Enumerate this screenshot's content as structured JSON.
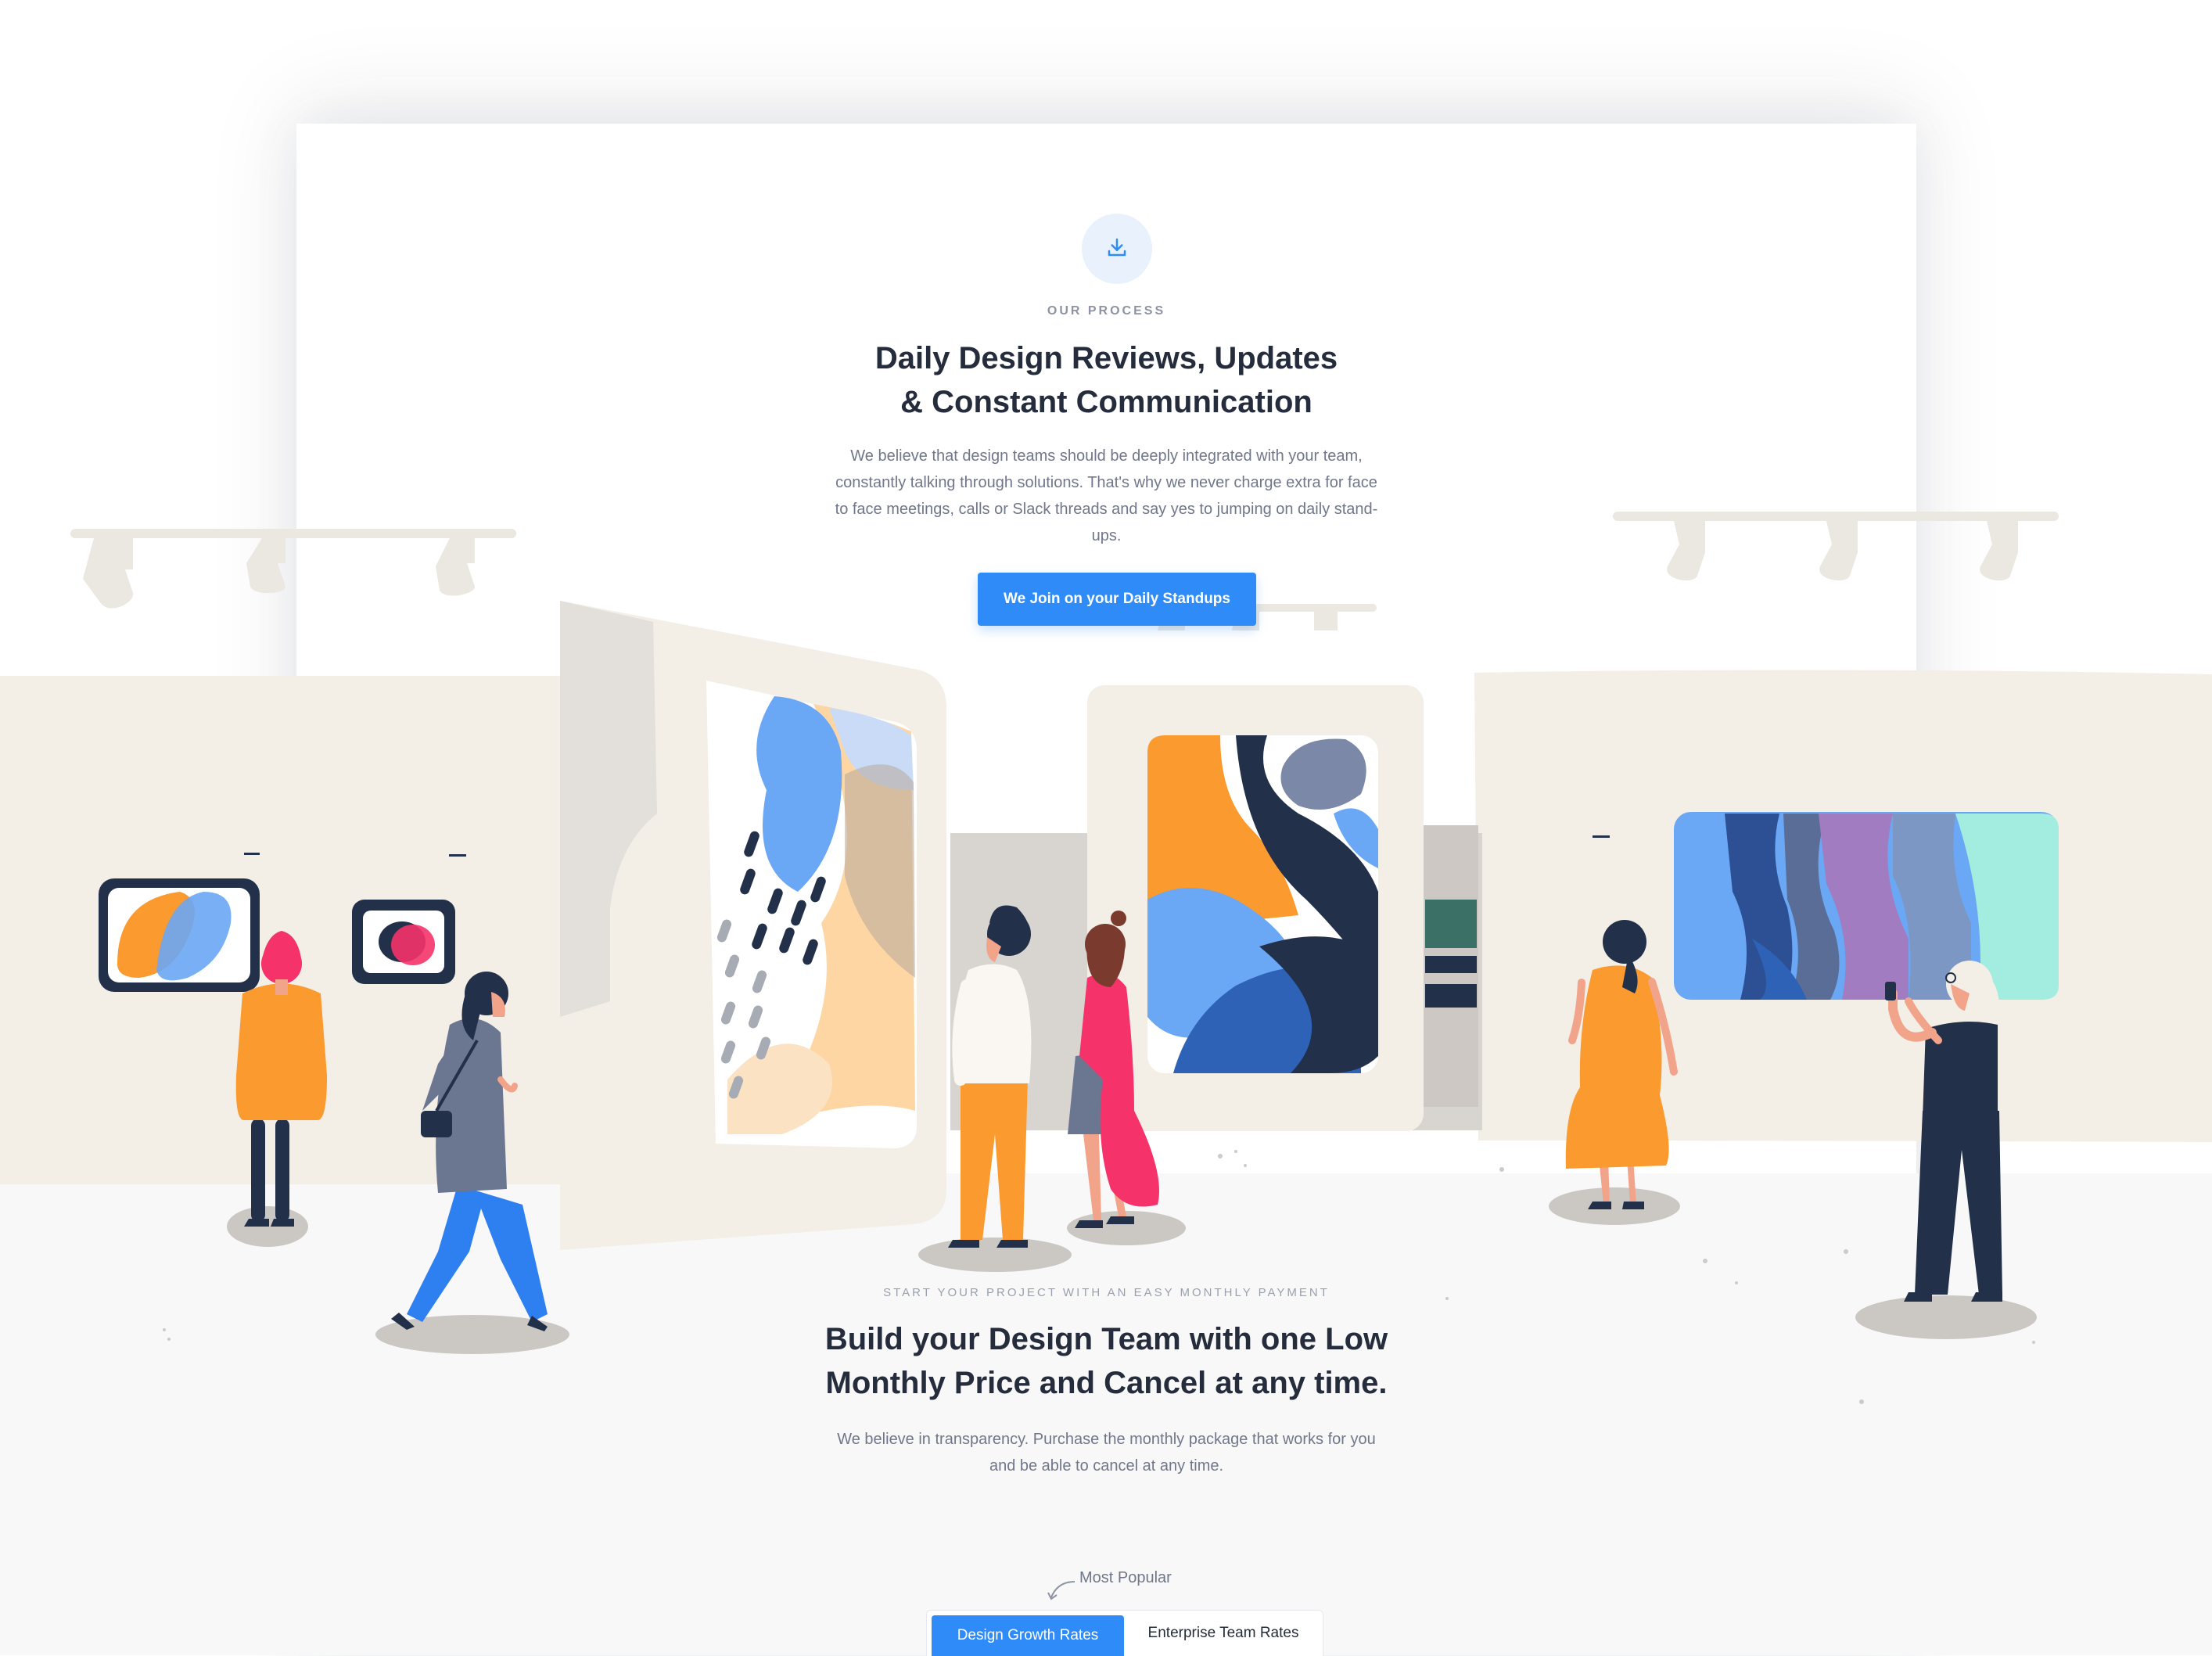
{
  "process": {
    "icon": "download-icon",
    "eyebrow": "OUR PROCESS",
    "title_line1": "Daily Design Reviews, Updates",
    "title_line2": "& Constant Communication",
    "body_line1": "We believe that design teams should be deeply integrated with your team,",
    "body_line2": "constantly talking through solutions. That's why we never charge extra for face",
    "body_line3": "to face meetings, calls or Slack threads and say yes to jumping on daily stand-",
    "body_line4": "ups.",
    "cta_label": "We Join on your Daily Standups"
  },
  "pricing": {
    "eyebrow": "START YOUR PROJECT WITH AN EASY MONTHLY PAYMENT",
    "title_line1": "Build your Design Team with one Low",
    "title_line2": "Monthly Price and Cancel at any time.",
    "body_line1": "We believe in transparency. Purchase the monthly package that works for you",
    "body_line2": "and be able to cancel at any time.",
    "popular_label": "Most Popular",
    "tabs": [
      {
        "label": "Design Growth Rates",
        "active": true
      },
      {
        "label": "Enterprise Team Rates",
        "active": false
      }
    ]
  },
  "colors": {
    "accent": "#2f8bf8",
    "heading": "#252c3c",
    "body": "#70778a",
    "wall": "#f3eee6",
    "orange": "#fb9a2e",
    "navy": "#22304a",
    "blue": "#6aa7f4",
    "pink": "#f5336a"
  }
}
